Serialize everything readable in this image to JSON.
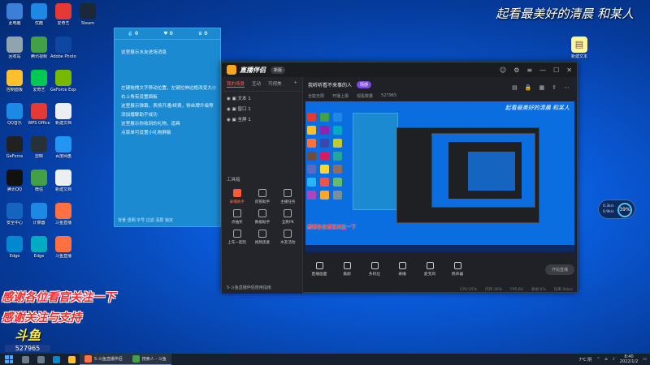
{
  "wallpaper_title": "起看最美好的清晨 和某人",
  "desktop_icons": [
    {
      "label": "此电脑",
      "icon": "computer-icon",
      "color": "#3c7fd6",
      "col": 0,
      "row": 0
    },
    {
      "label": "优酷",
      "icon": "youku-icon",
      "color": "#1e88e5",
      "col": 1,
      "row": 0
    },
    {
      "label": "爱奇艺",
      "icon": "iqiyi-icon",
      "color": "#e53935",
      "col": 2,
      "row": 0
    },
    {
      "label": "Steam",
      "icon": "steam-icon",
      "color": "#1b2838",
      "col": 3,
      "row": 0
    },
    {
      "label": "回收站",
      "icon": "recycle-bin-icon",
      "color": "#90a4ae",
      "col": 0,
      "row": 1
    },
    {
      "label": "腾讯视频",
      "icon": "tencent-video-icon",
      "color": "#43a047",
      "col": 1,
      "row": 1
    },
    {
      "label": "Adobe Photoshop",
      "icon": "photoshop-icon",
      "color": "#0d47a1",
      "col": 2,
      "row": 1
    },
    {
      "label": "控制面板",
      "icon": "control-panel-icon",
      "color": "#fbc02d",
      "col": 0,
      "row": 2
    },
    {
      "label": "爱奇艺",
      "icon": "iqiyi-icon",
      "color": "#00c853",
      "col": 1,
      "row": 2
    },
    {
      "label": "GeForce Experience",
      "icon": "geforce-icon",
      "color": "#76b900",
      "col": 2,
      "row": 2
    },
    {
      "label": "QQ音乐",
      "icon": "qq-music-icon",
      "color": "#1e88e5",
      "col": 0,
      "row": 3
    },
    {
      "label": "WPS Office",
      "icon": "wps-icon",
      "color": "#e53935",
      "col": 1,
      "row": 3
    },
    {
      "label": "新建文档",
      "icon": "document-icon",
      "color": "#eceff1",
      "col": 2,
      "row": 3
    },
    {
      "label": "GeForce",
      "icon": "geforce-icon",
      "color": "#212121",
      "col": 0,
      "row": 4
    },
    {
      "label": "剪映",
      "icon": "capcut-icon",
      "color": "#263238",
      "col": 1,
      "row": 4
    },
    {
      "label": "百度网盘",
      "icon": "baidu-netdisk-icon",
      "color": "#2196f3",
      "col": 2,
      "row": 4
    },
    {
      "label": "腾讯QQ",
      "icon": "qq-icon",
      "color": "#111111",
      "col": 0,
      "row": 5
    },
    {
      "label": "微信",
      "icon": "wechat-icon",
      "color": "#43a047",
      "col": 1,
      "row": 5
    },
    {
      "label": "新建文档",
      "icon": "document-icon",
      "color": "#eceff1",
      "col": 2,
      "row": 5
    },
    {
      "label": "安全中心",
      "icon": "security-icon",
      "color": "#1565c0",
      "col": 0,
      "row": 6
    },
    {
      "label": "计算器",
      "icon": "calculator-icon",
      "color": "#1e88e5",
      "col": 1,
      "row": 6
    },
    {
      "label": "斗鱼直播",
      "icon": "douyu-icon",
      "color": "#ff7043",
      "col": 2,
      "row": 6
    },
    {
      "label": "Edge",
      "icon": "edge-icon",
      "color": "#0288d1",
      "col": 0,
      "row": 7
    },
    {
      "label": "Edge",
      "icon": "edge-icon",
      "color": "#00acc1",
      "col": 1,
      "row": 7
    },
    {
      "label": "斗鱼直播",
      "icon": "douyu-icon",
      "color": "#ff7043",
      "col": 2,
      "row": 7
    }
  ],
  "right_desktop_icon": {
    "label": "新建文本",
    "icon": "text-file-icon"
  },
  "chat": {
    "header": [
      "0",
      "0",
      "0"
    ],
    "messages": [
      "这里展示水友进场消息",
      "",
      "",
      "",
      "左键拖拽文字移动位置，左键拉伸边框改变大小",
      "右上角有设置面板",
      "这里展示弹幕，表扬开通/续费，粉丝牌升级等",
      "添加播聊助手成功",
      "这里展示你收到的礼物、道具",
      "点菜单可设置小礼物屏蔽"
    ],
    "footer": "背景 透明 字号 过滤 清屏 锁定"
  },
  "app": {
    "name": "直播伴侣",
    "version": "新版",
    "tabs": [
      "我的场景",
      "互动",
      "可视美"
    ],
    "sources": [
      "文本 1",
      "窗口 1",
      "全屏 1"
    ],
    "tools_label": "工具箱",
    "tools": [
      {
        "label": "录播助手",
        "icon": "record-icon",
        "hot": true
      },
      {
        "label": "房管助手",
        "icon": "admin-icon",
        "hot": false
      },
      {
        "label": "主播任务",
        "icon": "task-icon",
        "hot": false
      },
      {
        "label": "点抽奖",
        "icon": "lottery-icon",
        "hot": false
      },
      {
        "label": "数据助手",
        "icon": "data-icon",
        "hot": false
      },
      {
        "label": "全民PK",
        "icon": "pk-icon",
        "hot": false
      },
      {
        "label": "上车一起玩",
        "icon": "carpool-icon",
        "hot": false
      },
      {
        "label": "视频连麦",
        "icon": "mic-link-icon",
        "hot": false
      },
      {
        "label": "水友活动",
        "icon": "event-icon",
        "hot": false
      }
    ],
    "bottom_hint": "5·斗鱼直播伴侣使用指南",
    "stream_title": "我听听看不来事的人",
    "stream_badge": "情感",
    "stream_meta": [
      "全能无限",
      "开播上报",
      "观看数量",
      "527965"
    ],
    "preview_title": "起看最美好的清晨 和某人",
    "controls": [
      "直播画面",
      "美颜",
      "多机位",
      "录播",
      "麦克风",
      "扬声器"
    ],
    "start_label": "开始直播",
    "status": [
      "CPU:25%",
      "内存:36%",
      "FPS:60",
      "丢帧:0%",
      "码率:0kb/s"
    ]
  },
  "widget": {
    "up": "0.3k/s",
    "down": "0.9k/s",
    "percent": "39%"
  },
  "overlay_lines": [
    "感谢各位看官关注一下",
    "感谢关注与支持"
  ],
  "douyu": {
    "name": "斗鱼",
    "room_id": "527965"
  },
  "taskbar": {
    "apps": [
      {
        "label": "5·斗鱼直播伴侣",
        "icon": "douyu-app-icon"
      },
      {
        "label": "搜索人 - 斗鱼",
        "icon": "browser-icon"
      }
    ],
    "weather": "7°C 阴",
    "time": "8:40",
    "date": "2022/1/2"
  }
}
